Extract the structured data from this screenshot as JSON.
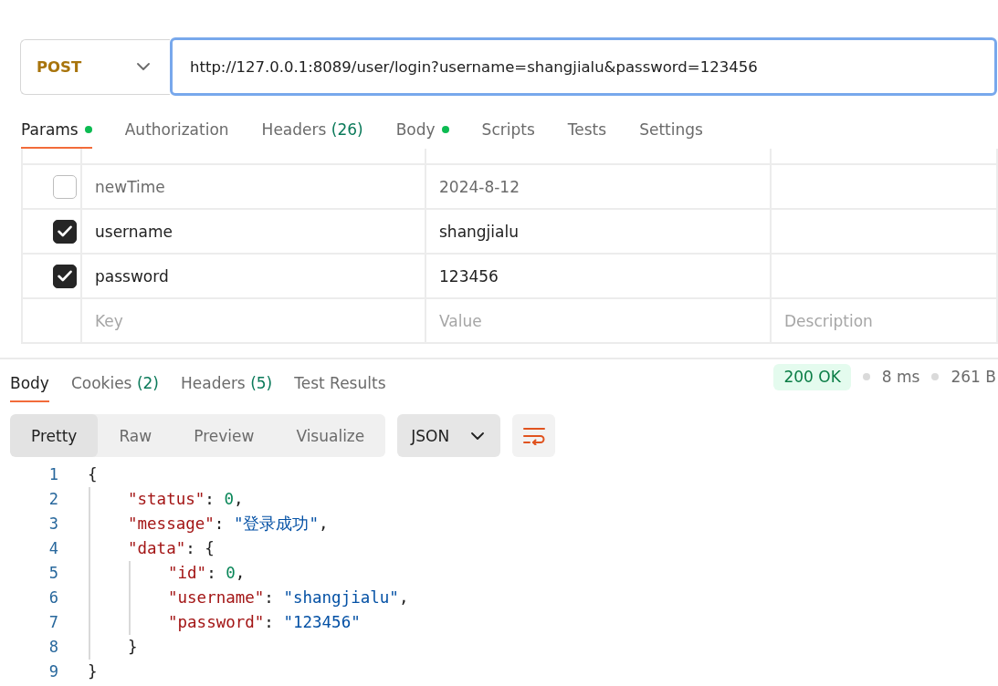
{
  "request": {
    "method": "POST",
    "url": "http://127.0.0.1:8089/user/login?username=shangjialu&password=123456"
  },
  "request_tabs": [
    {
      "label": "Params",
      "selected": true,
      "dot": true
    },
    {
      "label": "Authorization",
      "selected": false,
      "dot": false
    },
    {
      "label": "Headers",
      "count": "(26)",
      "selected": false,
      "dot": false
    },
    {
      "label": "Body",
      "selected": false,
      "dot": true
    },
    {
      "label": "Scripts",
      "selected": false,
      "dot": false
    },
    {
      "label": "Tests",
      "selected": false,
      "dot": false
    },
    {
      "label": "Settings",
      "selected": false,
      "dot": false
    }
  ],
  "params": {
    "rows": [
      {
        "checked": false,
        "key": "newTime",
        "value": "2024-8-12"
      },
      {
        "checked": true,
        "key": "username",
        "value": "shangjialu"
      },
      {
        "checked": true,
        "key": "password",
        "value": "123456"
      }
    ],
    "new_row": {
      "key_placeholder": "Key",
      "value_placeholder": "Value",
      "description_placeholder": "Description"
    }
  },
  "response_tabs": [
    {
      "label": "Body",
      "selected": true
    },
    {
      "label": "Cookies",
      "count": "(2)",
      "selected": false
    },
    {
      "label": "Headers",
      "count": "(5)",
      "selected": false
    },
    {
      "label": "Test Results",
      "selected": false
    }
  ],
  "status": {
    "code": "200 OK",
    "time": "8 ms",
    "size": "261 B"
  },
  "view_modes": [
    {
      "label": "Pretty",
      "selected": true
    },
    {
      "label": "Raw",
      "selected": false
    },
    {
      "label": "Preview",
      "selected": false
    },
    {
      "label": "Visualize",
      "selected": false
    }
  ],
  "format": "JSON",
  "code_lines": [
    {
      "number": "1",
      "tokens": [
        {
          "kind": "punct",
          "text": "{"
        }
      ],
      "children": [
        {
          "number": "2",
          "tokens": [
            {
              "kind": "key",
              "text": "\"status\""
            },
            {
              "kind": "punct",
              "text": ": "
            },
            {
              "kind": "number",
              "text": "0"
            },
            {
              "kind": "punct",
              "text": ","
            }
          ]
        },
        {
          "number": "3",
          "tokens": [
            {
              "kind": "key",
              "text": "\"message\""
            },
            {
              "kind": "punct",
              "text": ": "
            },
            {
              "kind": "string",
              "text": "\"登录成功\""
            },
            {
              "kind": "punct",
              "text": ","
            }
          ]
        },
        {
          "number": "4",
          "tokens": [
            {
              "kind": "key",
              "text": "\"data\""
            },
            {
              "kind": "punct",
              "text": ": {"
            }
          ],
          "children": [
            {
              "number": "5",
              "tokens": [
                {
                  "kind": "key",
                  "text": "\"id\""
                },
                {
                  "kind": "punct",
                  "text": ": "
                },
                {
                  "kind": "number",
                  "text": "0"
                },
                {
                  "kind": "punct",
                  "text": ","
                }
              ]
            },
            {
              "number": "6",
              "tokens": [
                {
                  "kind": "key",
                  "text": "\"username\""
                },
                {
                  "kind": "punct",
                  "text": ": "
                },
                {
                  "kind": "string",
                  "text": "\"shangjialu\""
                },
                {
                  "kind": "punct",
                  "text": ","
                }
              ]
            },
            {
              "number": "7",
              "tokens": [
                {
                  "kind": "key",
                  "text": "\"password\""
                },
                {
                  "kind": "punct",
                  "text": ": "
                },
                {
                  "kind": "string",
                  "text": "\"123456\""
                }
              ]
            }
          ]
        },
        {
          "number": "8",
          "tokens": [
            {
              "kind": "punct",
              "text": "}"
            }
          ]
        }
      ]
    },
    {
      "number": "9",
      "tokens": [
        {
          "kind": "punct",
          "text": "}"
        }
      ]
    }
  ]
}
